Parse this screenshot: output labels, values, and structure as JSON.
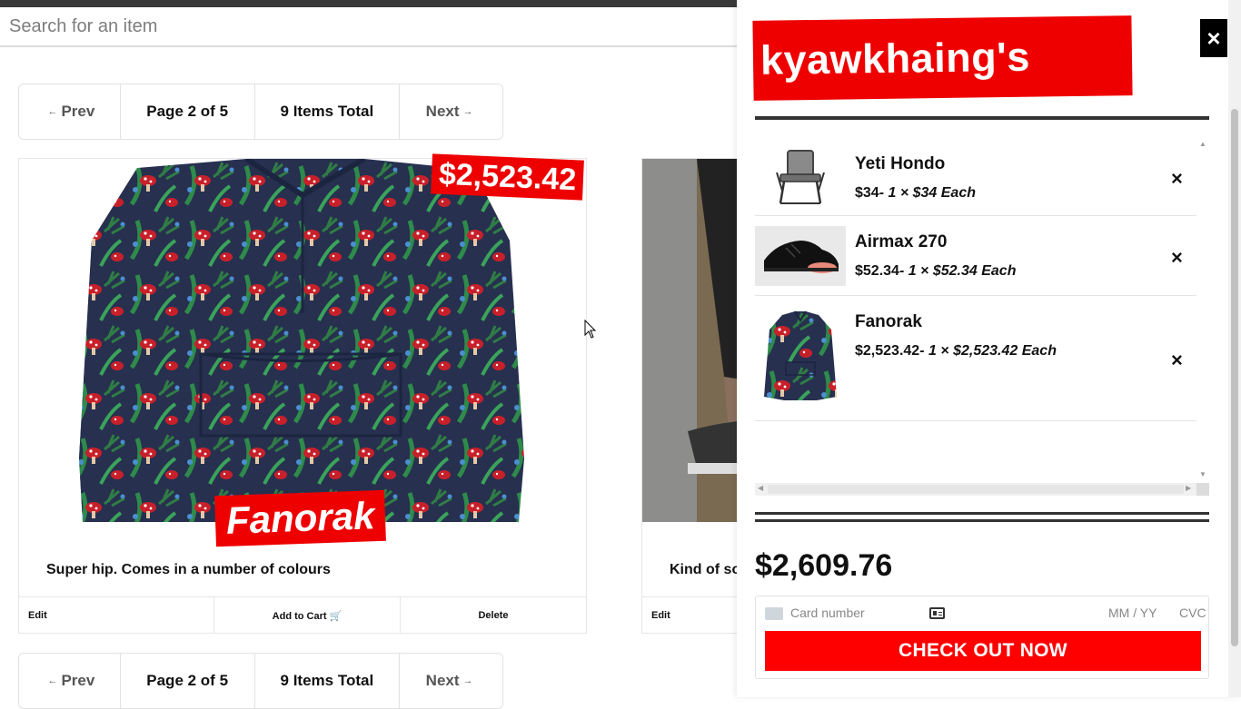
{
  "search": {
    "placeholder": "Search for an item"
  },
  "pagination": {
    "prev": "Prev",
    "page": "Page 2 of 5",
    "total": "9 Items Total",
    "next": "Next"
  },
  "products": [
    {
      "name": "Fanorak",
      "price": "$2,523.42",
      "description": "Super hip. Comes in a number of colours",
      "actions": {
        "edit": "Edit",
        "add_to_cart": "Add to Cart 🛒",
        "delete": "Delete"
      }
    },
    {
      "description": "Kind of so",
      "actions": {
        "edit": "Edit"
      }
    }
  ],
  "cart": {
    "title": "kyawkhaing's carts",
    "close": "×",
    "items": [
      {
        "name": "Yeti Hondo",
        "price": "$34",
        "detail": "- 1 × $34 Each",
        "remove": "×",
        "icon": "chair-icon"
      },
      {
        "name": "Airmax 270",
        "price": "$52.34",
        "detail": "- 1 × $52.34 Each",
        "remove": "×",
        "icon": "sneaker-icon"
      },
      {
        "name": "Fanorak",
        "price": "$2,523.42",
        "detail": "- 1 × $2,523.42 Each",
        "remove": "×",
        "icon": "jacket-icon"
      }
    ],
    "total": "$2,609.76",
    "payment": {
      "card_number_placeholder": "Card number",
      "expiry_placeholder": "MM / YY",
      "cvc_placeholder": "CVC"
    },
    "checkout": "CHECK OUT NOW"
  },
  "colors": {
    "accent": "#ee0000",
    "checkout": "#ff0000",
    "topbar": "#393939"
  }
}
